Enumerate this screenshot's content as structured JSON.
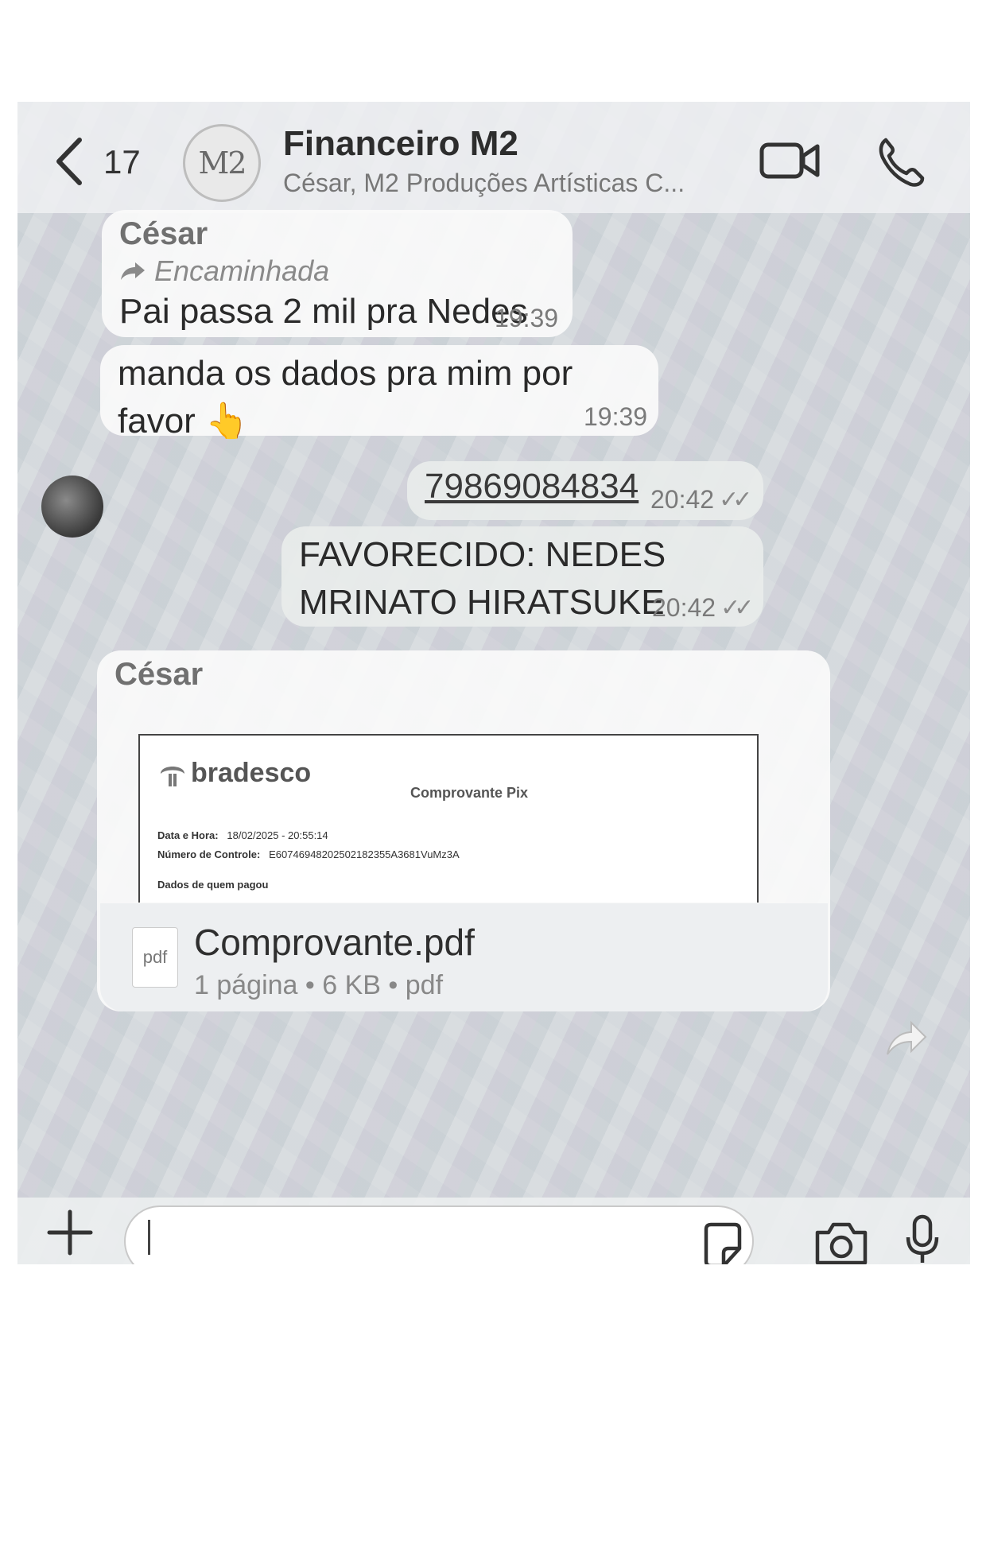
{
  "header": {
    "back_count": "17",
    "avatar_text": "M2",
    "title": "Financeiro M2",
    "subtitle": "César, M2 Produções Artísticas C..."
  },
  "messages": [
    {
      "sender": "César",
      "forwarded_label": "Encaminhada",
      "text": "Pai passa 2 mil pra Nedes",
      "time": "19:39"
    },
    {
      "text": "manda os dados pra mim por favor 👆",
      "time": "19:39"
    },
    {
      "text": "79869084834",
      "time": "20:42"
    },
    {
      "text": "FAVORECIDO: NEDES MRINATO HIRATSUKE",
      "time": "20:42"
    }
  ],
  "attachment": {
    "sender": "César",
    "preview": {
      "bank": "bradesco",
      "heading": "Comprovante Pix",
      "date_label": "Data e Hora:",
      "date_value": "18/02/2025 - 20:55:14",
      "control_label": "Número de Controle:",
      "control_value": "E60746948202502182355A3681VuMz3A",
      "payer_section": "Dados de quem pagou"
    },
    "file_icon_label": "pdf",
    "file_name": "Comprovante.pdf",
    "file_meta": "1 página • 6 KB • pdf"
  },
  "composer": {
    "input_value": ""
  },
  "icons": {
    "back": "chevron-left-icon",
    "video": "video-camera-icon",
    "phone": "phone-icon",
    "forward": "forward-arrow-icon",
    "read": "double-check-icon",
    "share": "share-icon",
    "plus": "plus-icon",
    "sticker": "sticker-icon",
    "camera": "camera-icon",
    "mic": "microphone-icon"
  }
}
